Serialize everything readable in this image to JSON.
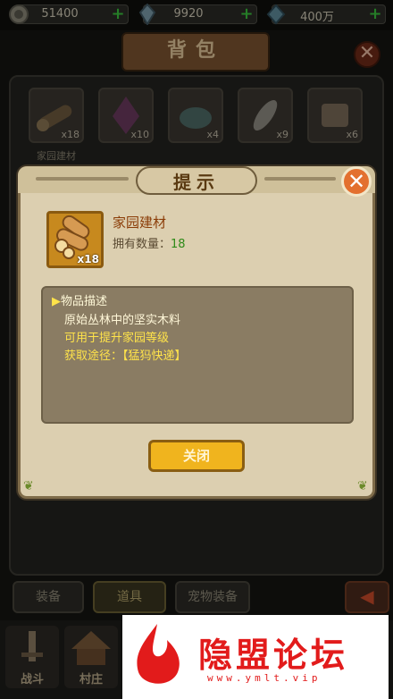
{
  "currencies": [
    {
      "value": "51400",
      "icon": "coin-icon"
    },
    {
      "value": "9920",
      "icon": "crystal-icon"
    },
    {
      "value": "400万",
      "icon": "gem-icon"
    }
  ],
  "bag": {
    "title": "背包",
    "slots": [
      {
        "count": "x18",
        "label": "家园建材"
      },
      {
        "count": "x10",
        "label": ""
      },
      {
        "count": "x4",
        "label": ""
      },
      {
        "count": "x9",
        "label": ""
      },
      {
        "count": "x6",
        "label": ""
      }
    ]
  },
  "tabs": [
    "装备",
    "道具",
    "宠物装备"
  ],
  "bottom_nav": [
    "战斗",
    "村庄"
  ],
  "watermark": {
    "text": "隐盟论坛",
    "url": "www.ymlt.vip"
  },
  "modal": {
    "title": "提示",
    "item": {
      "name": "家园建材",
      "count_badge": "x18",
      "owned_label": "拥有数量：",
      "owned_value": "18"
    },
    "description": {
      "heading": "物品描述",
      "line1": "原始丛林中的坚实木料",
      "line2": "可用于提升家园等级",
      "line3": "获取途径：【猛犸快递】"
    },
    "close_label": "关闭"
  },
  "colors": {
    "accent_orange": "#f0b41e",
    "name_brown": "#8b3d08",
    "highlight_yellow": "#ffe34a",
    "owned_green": "#2e8a18"
  }
}
